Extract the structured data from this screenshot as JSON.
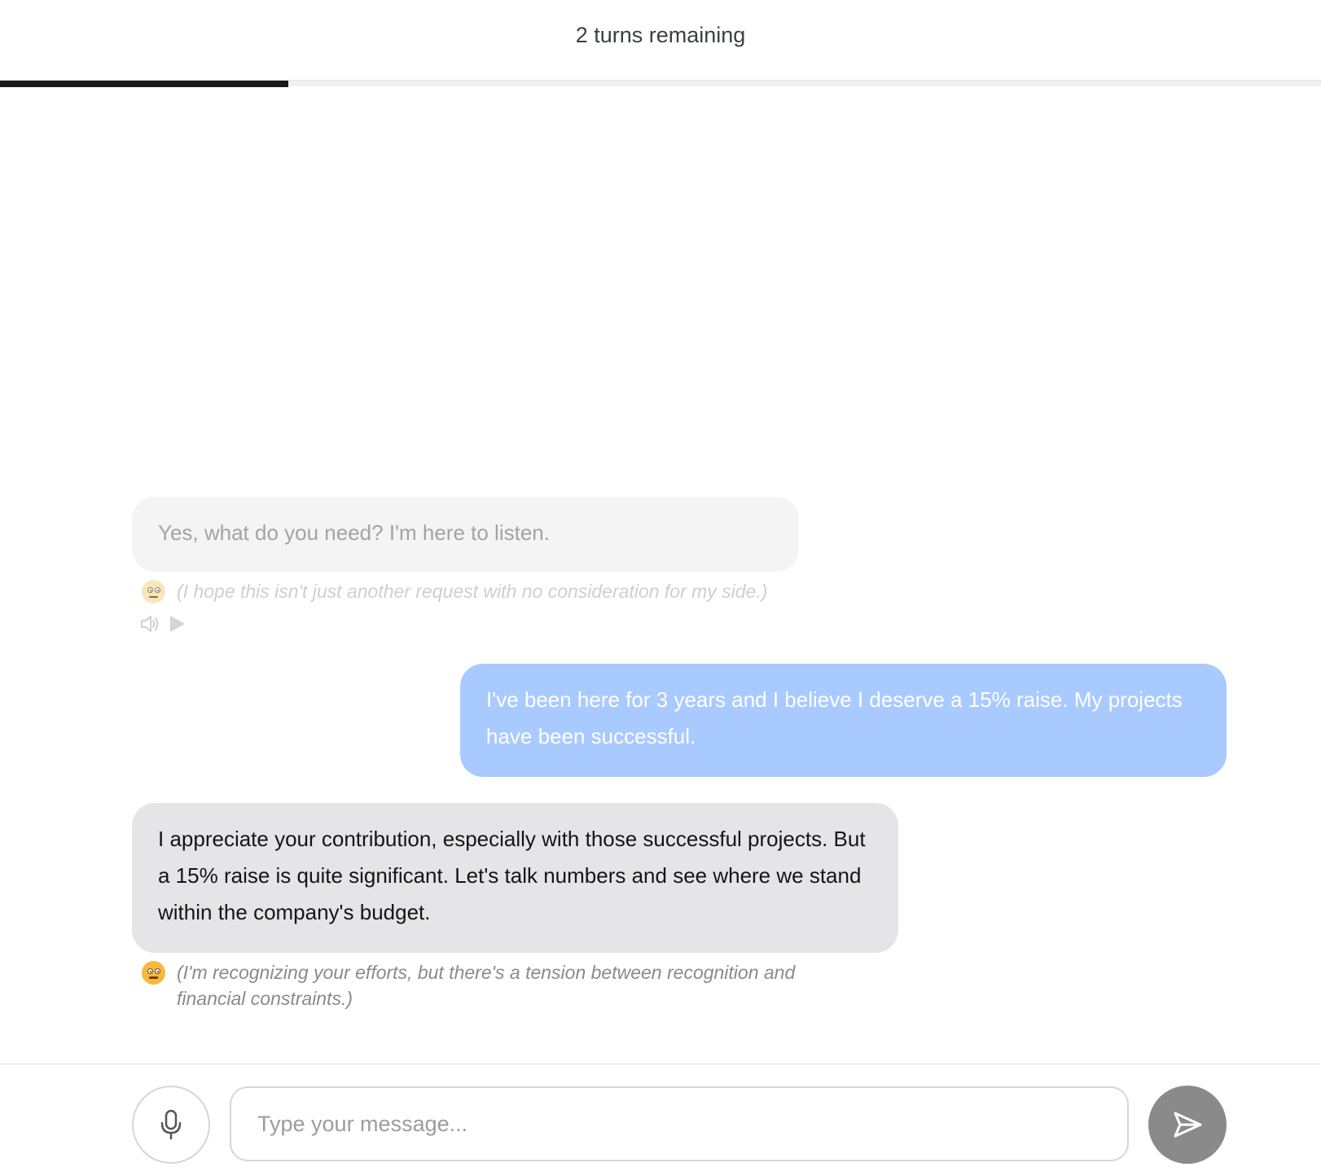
{
  "header": {
    "turns_remaining_text": "2 turns remaining",
    "progress_fraction": 0.218
  },
  "messages": [
    {
      "role": "assistant",
      "state": "faded",
      "text": "Yes, what do you need? I'm here to listen.",
      "thought": "(I hope this isn't just another request with no consideration for my side.)",
      "emotion_icon": "neutral-face-icon",
      "audio_icons": [
        "speaker-icon",
        "play-icon"
      ]
    },
    {
      "role": "user",
      "text": "I've been here for 3 years and I believe I deserve a 15% raise. My projects have been  successful."
    },
    {
      "role": "assistant",
      "state": "active",
      "text": "I appreciate your contribution, especially with those successful projects. But a 15% raise is quite significant. Let's talk numbers and see where we stand within the company's budget.",
      "thought": "(I'm recognizing your efforts, but there's a tension between recognition and financial constraints.)",
      "emotion_icon": "grimacing-face-icon"
    }
  ],
  "input": {
    "placeholder": "Type your message...",
    "value": ""
  },
  "icons": {
    "mic": "microphone-icon",
    "send": "send-icon"
  },
  "colors": {
    "user_bubble": "#a8caff",
    "assistant_bubble": "#e5e5e7",
    "assistant_bubble_faded": "#f4f4f4",
    "progress_fill": "#1a1a1a",
    "send_button": "#8a8a8a"
  }
}
